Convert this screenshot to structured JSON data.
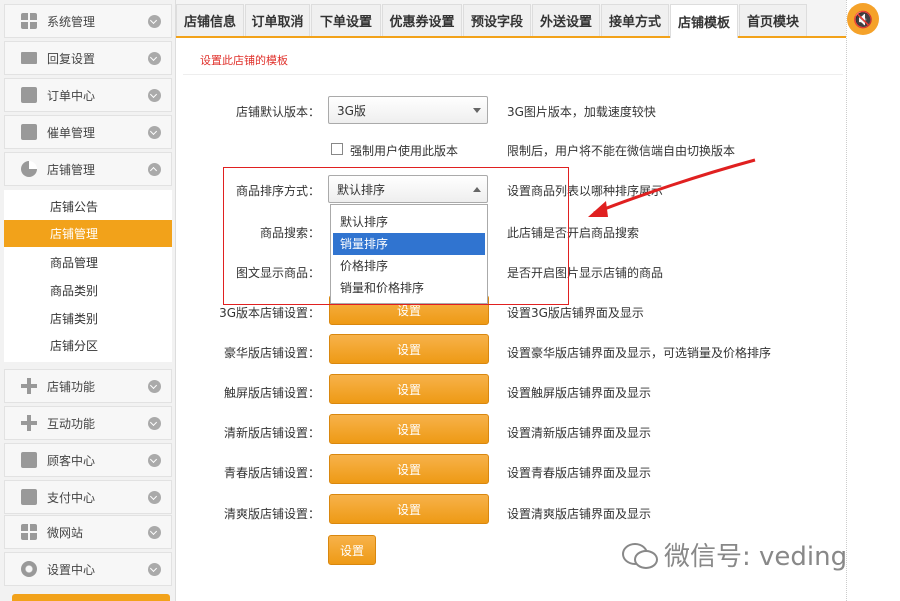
{
  "sidebar": {
    "items": [
      {
        "label": "系统管理",
        "icon": "grid-icon"
      },
      {
        "label": "回复设置",
        "icon": "mail-icon"
      },
      {
        "label": "订单中心",
        "icon": "printer-icon"
      },
      {
        "label": "催单管理",
        "icon": "printer-icon"
      },
      {
        "label": "店铺管理",
        "icon": "pie-icon"
      }
    ],
    "submenu": [
      "店铺公告",
      "店铺管理",
      "商品管理",
      "商品类别",
      "店铺类别",
      "店铺分区"
    ],
    "active_submenu": "店铺管理",
    "items_bottom": [
      {
        "label": "店铺功能",
        "icon": "plus-icon"
      },
      {
        "label": "互动功能",
        "icon": "plus-icon"
      },
      {
        "label": "顾客中心",
        "icon": "printer-icon"
      },
      {
        "label": "支付中心",
        "icon": "inbox-icon"
      },
      {
        "label": "微网站",
        "icon": "grid-icon"
      },
      {
        "label": "设置中心",
        "icon": "gear-icon"
      }
    ]
  },
  "tabs": [
    "店铺信息",
    "订单取消",
    "下单设置",
    "优惠券设置",
    "预设字段",
    "外送设置",
    "接单方式",
    "店铺模板",
    "首页模块"
  ],
  "active_tab": "店铺模板",
  "main": {
    "subtitle": "设置此店铺的模板",
    "default_version": {
      "label": "店铺默认版本：",
      "value": "3G版",
      "desc": "3G图片版本，加载速度较快"
    },
    "force": {
      "label": "强制用户使用此版本",
      "desc": "限制后，用户将不能在微信端自由切换版本"
    },
    "sort": {
      "label": "商品排序方式：",
      "value": "默认排序",
      "desc": "设置商品列表以哪种排序展示",
      "options": [
        "默认排序",
        "销量排序",
        "价格排序",
        "销量和价格排序"
      ],
      "highlighted": "销量排序"
    },
    "search": {
      "label": "商品搜索：",
      "desc": "此店铺是否开启商品搜索"
    },
    "image_text": {
      "label": "图文显示商品：",
      "desc": "是否开启图片显示店铺的商品"
    },
    "settings_rows": [
      {
        "label": "3G版本店铺设置：",
        "button": "设置",
        "desc": "设置3G版店铺界面及显示"
      },
      {
        "label": "豪华版店铺设置：",
        "button": "设置",
        "desc": "设置豪华版店铺界面及显示，可选销量及价格排序"
      },
      {
        "label": "触屏版店铺设置：",
        "button": "设置",
        "desc": "设置触屏版店铺界面及显示"
      },
      {
        "label": "清新版店铺设置：",
        "button": "设置",
        "desc": "设置清新版店铺界面及显示"
      },
      {
        "label": "青春版店铺设置：",
        "button": "设置",
        "desc": "设置青春版店铺界面及显示"
      },
      {
        "label": "清爽版店铺设置：",
        "button": "设置",
        "desc": "设置清爽版店铺界面及显示"
      }
    ],
    "save_button": "设置"
  },
  "watermark": "微信号: veding",
  "colors": {
    "accent": "#f2a21a",
    "highlight": "#e02020",
    "selection": "#3074d0"
  }
}
